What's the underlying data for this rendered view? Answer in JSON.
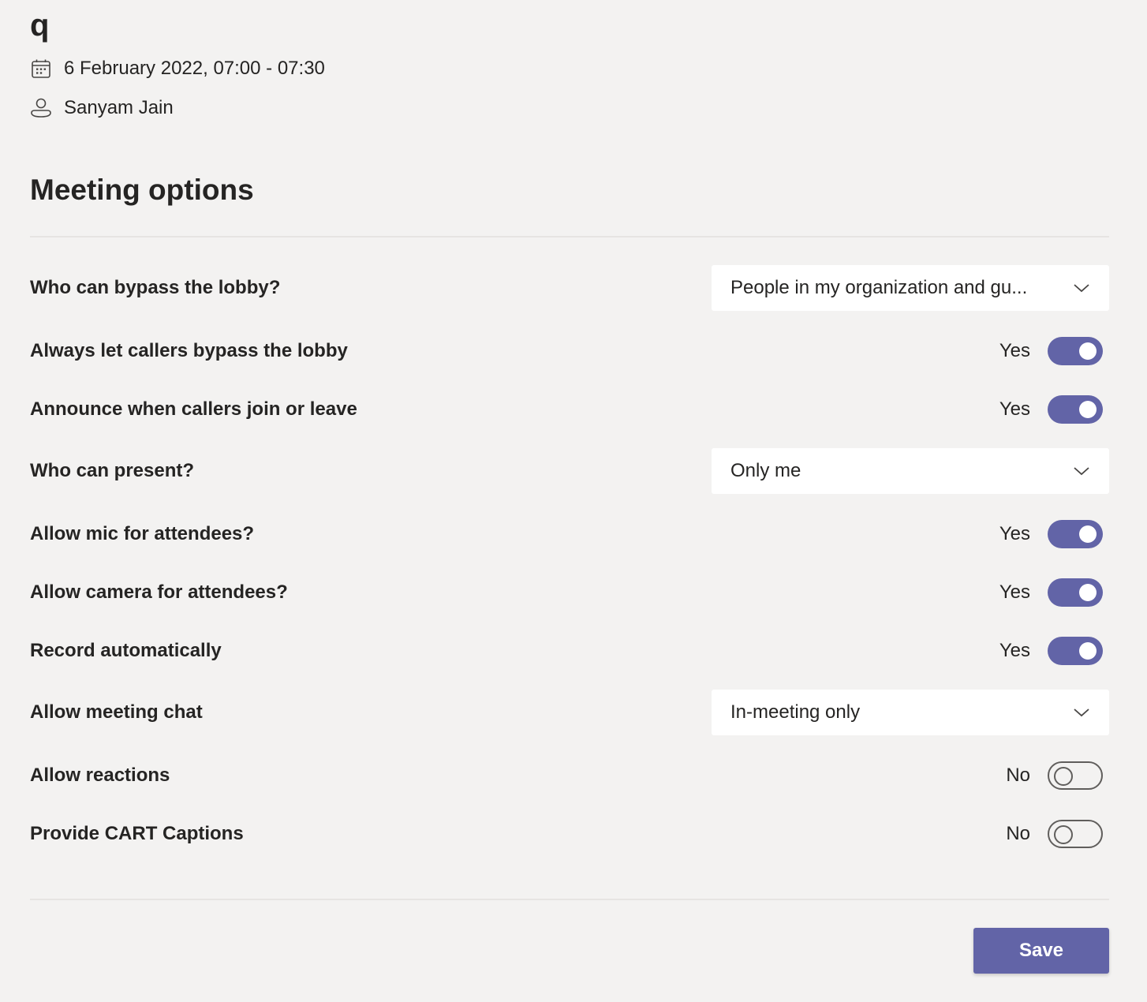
{
  "meeting": {
    "title": "q",
    "date_time": "6 February 2022, 07:00 - 07:30",
    "organizer": "Sanyam Jain",
    "date_icon": "calendar-icon",
    "organizer_icon": "person-icon"
  },
  "section_title": "Meeting options",
  "options": [
    {
      "label": "Who can bypass the lobby?",
      "type": "dropdown",
      "value": "People in my organization and gu..."
    },
    {
      "label": "Always let callers bypass the lobby",
      "type": "toggle",
      "state": "Yes"
    },
    {
      "label": "Announce when callers join or leave",
      "type": "toggle",
      "state": "Yes"
    },
    {
      "label": "Who can present?",
      "type": "dropdown",
      "value": "Only me"
    },
    {
      "label": "Allow mic for attendees?",
      "type": "toggle",
      "state": "Yes"
    },
    {
      "label": "Allow camera for attendees?",
      "type": "toggle",
      "state": "Yes"
    },
    {
      "label": "Record automatically",
      "type": "toggle",
      "state": "Yes"
    },
    {
      "label": "Allow meeting chat",
      "type": "dropdown",
      "value": "In-meeting only"
    },
    {
      "label": "Allow reactions",
      "type": "toggle",
      "state": "No"
    },
    {
      "label": "Provide CART Captions",
      "type": "toggle",
      "state": "No"
    }
  ],
  "save_label": "Save",
  "colors": {
    "accent": "#6264a7",
    "background": "#f3f2f1",
    "text": "#252423",
    "dropdown_bg": "#ffffff"
  }
}
